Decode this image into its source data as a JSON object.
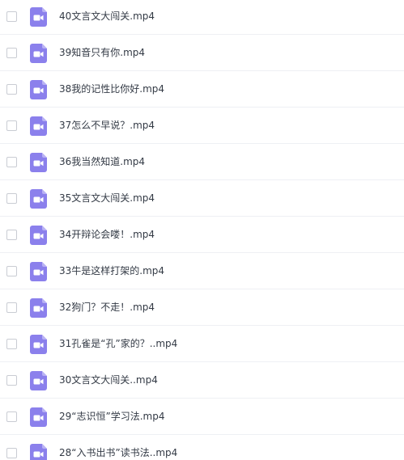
{
  "files": [
    {
      "name": "40文言文大闯关.mp4",
      "icon": "video-file-icon"
    },
    {
      "name": "39知音只有你.mp4",
      "icon": "video-file-icon"
    },
    {
      "name": "38我的记性比你好.mp4",
      "icon": "video-file-icon"
    },
    {
      "name": "37怎么不早说？.mp4",
      "icon": "video-file-icon"
    },
    {
      "name": "36我当然知道.mp4",
      "icon": "video-file-icon"
    },
    {
      "name": "35文言文大闯关.mp4",
      "icon": "video-file-icon"
    },
    {
      "name": "34开辩论会喽！.mp4",
      "icon": "video-file-icon"
    },
    {
      "name": "33牛是这样打架的.mp4",
      "icon": "video-file-icon"
    },
    {
      "name": "32狗门？不走！.mp4",
      "icon": "video-file-icon"
    },
    {
      "name": "31孔雀是“孔”家的？..mp4",
      "icon": "video-file-icon"
    },
    {
      "name": "30文言文大闯关..mp4",
      "icon": "video-file-icon"
    },
    {
      "name": "29“志识恒”学习法.mp4",
      "icon": "video-file-icon"
    },
    {
      "name": "28“入书出书”读书法..mp4",
      "icon": "video-file-icon"
    }
  ],
  "colors": {
    "icon_bg": "#8b80ec",
    "icon_fold": "#b9b2f4",
    "icon_glyph": "#ffffff",
    "text": "#333a45",
    "divider": "#eef0f4",
    "checkbox_border": "#c9ccd3"
  }
}
